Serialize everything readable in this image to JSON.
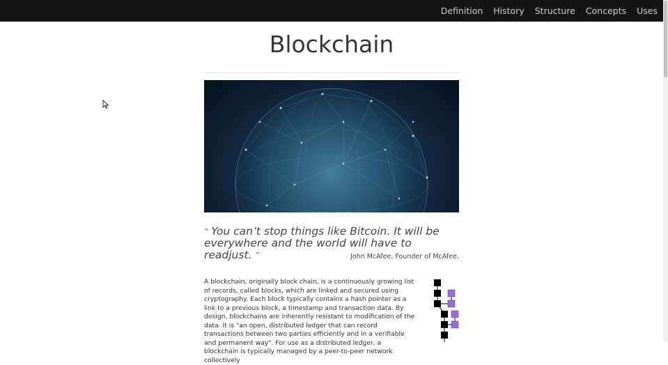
{
  "nav": {
    "items": [
      "Definition",
      "History",
      "Structure",
      "Concepts",
      "Uses"
    ]
  },
  "page": {
    "title": "Blockchain"
  },
  "hero": {
    "image": "globe-network-image"
  },
  "quote": {
    "open_mark": "“",
    "text": "You can’t stop things like Bitcoin. It will be everywhere and the world will have to readjust.",
    "close_mark": "”",
    "author": "John McAfee, Founder of McAfee."
  },
  "article": {
    "paragraph": "A blockchain, originally block chain, is a continuously growing list of records, called blocks, which are linked and secured using cryptography. Each block typically contains a hash pointer as a link to a previous block, a timestamp and transaction data. By design, blockchains are inherently resistant to modification of the data. It is \"an open, distributed ledger that can record transactions between two parties efficiently and in a verifiable and permanent way\". For use as a distributed ledger, a blockchain is typically managed by a peer-to-peer network collectively"
  },
  "colors": {
    "navbar": "#151515",
    "block_main": "#000000",
    "block_orphan": "#9b6fd0"
  }
}
